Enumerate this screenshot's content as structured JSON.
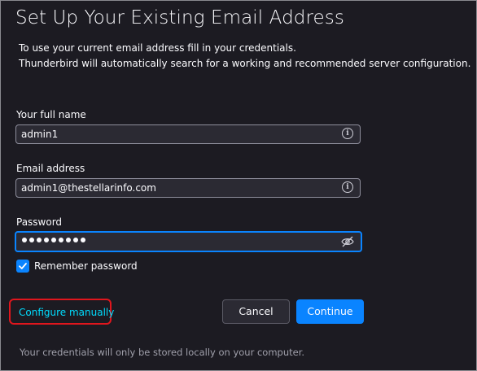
{
  "header": {
    "title": "Set Up Your Existing Email Address",
    "description_line1": "To use your current email address fill in your credentials.",
    "description_line2": "Thunderbird will automatically search for a working and recommended server configuration."
  },
  "form": {
    "full_name": {
      "label": "Your full name",
      "value": "admin1",
      "icon": "info-icon"
    },
    "email": {
      "label": "Email address",
      "value": "admin1@thestellarinfo.com",
      "icon": "info-icon"
    },
    "password": {
      "label": "Password",
      "masked_length": 9,
      "icon": "eye-slash-icon"
    },
    "remember": {
      "label": "Remember password",
      "checked": true
    }
  },
  "actions": {
    "configure_manually": "Configure manually",
    "cancel": "Cancel",
    "continue": "Continue"
  },
  "footer": {
    "note": "Your credentials will only be stored locally on your computer."
  },
  "colors": {
    "background": "#1c1b22",
    "accent": "#0a84ff",
    "link": "#00ddff",
    "highlight_annotation": "#e0161d"
  }
}
